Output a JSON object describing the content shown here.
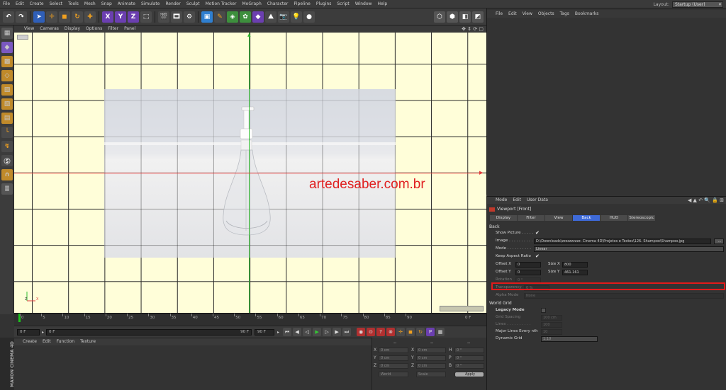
{
  "menubar": {
    "items": [
      "File",
      "Edit",
      "Create",
      "Select",
      "Tools",
      "Mesh",
      "Snap",
      "Animate",
      "Simulate",
      "Render",
      "Sculpt",
      "Motion Tracker",
      "MoGraph",
      "Character",
      "Pipeline",
      "Plugins",
      "Script",
      "Window",
      "Help"
    ],
    "layout_label": "Layout:",
    "layout_value": "Startup (User)"
  },
  "toolbar": {
    "icons": [
      "undo-icon",
      "live-selection-icon",
      "move-icon",
      "scale-icon",
      "rotate-icon",
      "last-tool-icon",
      "x-axis-icon",
      "y-axis-icon",
      "z-axis-icon",
      "coordinate-system-icon",
      "render-view-icon",
      "render-picture-viewer-icon",
      "edit-render-settings-icon",
      "cube-icon",
      "pen-icon",
      "subdivision-icon",
      "array-icon",
      "deformer-icon",
      "environment-icon",
      "camera-icon",
      "light-icon"
    ],
    "axis_letters": [
      "X",
      "Y",
      "Z"
    ]
  },
  "viewport": {
    "menu": [
      "View",
      "Cameras",
      "Display",
      "Options",
      "Filter",
      "Panel"
    ],
    "watermark": "artedesaber.com.br",
    "axis_labels": {
      "x": "X",
      "y": "Y",
      "z": "Z"
    }
  },
  "timeline": {
    "ticks": [
      "0",
      "5",
      "10",
      "15",
      "20",
      "25",
      "30",
      "35",
      "40",
      "45",
      "50",
      "55",
      "60",
      "65",
      "70",
      "75",
      "80",
      "85",
      "90"
    ],
    "current_frame": "0 F",
    "start_field": "0 F",
    "end_field": "90 F",
    "end_field2": "90 F",
    "frame_indicator": "0 F"
  },
  "material_manager": {
    "menu": [
      "Create",
      "Edit",
      "Function",
      "Texture"
    ]
  },
  "maxon_logo": "MAXON CINEMA 4D",
  "coordinates": {
    "headers": [
      "--",
      "--",
      "--"
    ],
    "rows": [
      {
        "a": "X",
        "av": "0 cm",
        "b": "X",
        "bv": "0 cm",
        "c": "H",
        "cv": "0 °"
      },
      {
        "a": "Y",
        "av": "0 cm",
        "b": "Y",
        "bv": "0 cm",
        "c": "P",
        "cv": "0 °"
      },
      {
        "a": "Z",
        "av": "0 cm",
        "b": "Z",
        "bv": "0 cm",
        "c": "B",
        "cv": "0 °"
      }
    ],
    "world_select": "World",
    "scale_select": "Scale",
    "apply_label": "Apply"
  },
  "object_manager": {
    "menu": [
      "File",
      "Edit",
      "View",
      "Objects",
      "Tags",
      "Bookmarks"
    ]
  },
  "attribute_manager": {
    "menu": [
      "Mode",
      "Edit",
      "User Data"
    ],
    "title": "Viewport [Front]",
    "tabs": [
      "Display",
      "Filter",
      "View",
      "Back",
      "HUD",
      "Stereoscopic"
    ],
    "active_tab": "Back",
    "section_back": "Back",
    "show_picture_label": "Show Picture . . . . .",
    "show_picture_check": "✔",
    "image_label": "Image . . . . . . . . . .",
    "image_value": "D:\\Downloads\\zzzzzzzzzz. Cinema 4D\\Projetos e Testes\\126. Shampoo\\Shampoo.jpg",
    "image_browse": "...",
    "mode_label": "Mode . . . . . . . . . .",
    "mode_value": "Linear",
    "keep_aspect_label": "Keep Aspect Ratio",
    "keep_aspect_check": "✔",
    "offset_x_label": "Offset X",
    "offset_x_value": "0",
    "size_x_label": "Size X",
    "size_x_value": "800",
    "offset_y_label": "Offset Y",
    "offset_y_value": "0",
    "size_y_label": "Size Y",
    "size_y_value": "461.161",
    "rotation_label": "Rotation",
    "rotation_value": "0 °",
    "transparency_label": "Transparency",
    "transparency_value": "0 %",
    "alpha_mode_label": "Alpha Mode",
    "alpha_mode_value": "None",
    "section_grid": "World Grid",
    "legacy_mode_label": "Legacy Mode",
    "grid_spacing_label": "Grid Spacing",
    "grid_spacing_value": "100 cm",
    "lines_label": "Lines . . . . . . . . . .",
    "lines_value": "100",
    "major_lines_label": "Major Lines Every nth",
    "major_lines_value": "10",
    "dynamic_grid_label": "Dynamic Grid",
    "dynamic_grid_value": "1:10"
  },
  "colors": {
    "viewport_bg": "#fffed9",
    "accent_blue": "#3e6ad8",
    "highlight_red": "#e21b1b",
    "axis_green": "#2fbf2f",
    "axis_red": "#e23a3a"
  }
}
